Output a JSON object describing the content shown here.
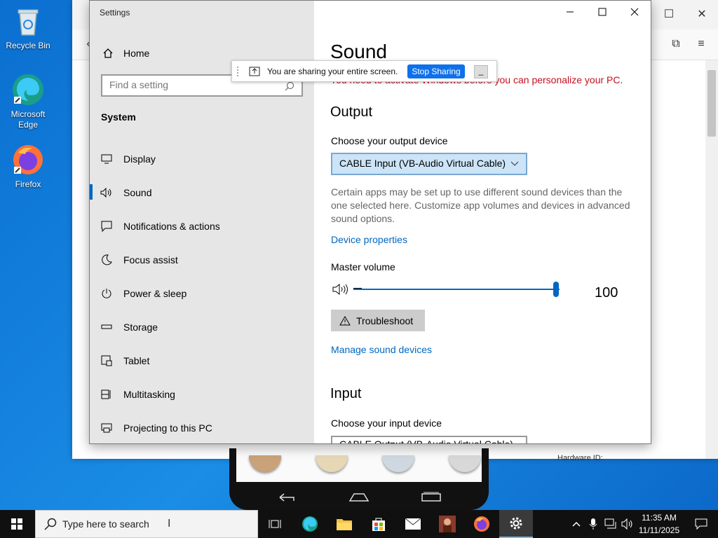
{
  "desktop": {
    "icons": [
      {
        "label": "Recycle Bin",
        "icon": "recycle-bin-icon"
      },
      {
        "label": "Microsoft Edge",
        "icon": "edge-icon"
      },
      {
        "label": "Firefox",
        "icon": "firefox-icon"
      }
    ]
  },
  "browser": {
    "hardware_id_text": "Hardware ID:"
  },
  "sharing_bar": {
    "message": "You are sharing your entire screen.",
    "stop_label": "Stop Sharing"
  },
  "settings": {
    "window_title": "Settings",
    "home_label": "Home",
    "search_placeholder": "Find a setting",
    "section_label": "System",
    "nav": [
      {
        "label": "Display",
        "icon": "display-icon"
      },
      {
        "label": "Sound",
        "icon": "sound-icon",
        "active": true
      },
      {
        "label": "Notifications & actions",
        "icon": "notifications-icon"
      },
      {
        "label": "Focus assist",
        "icon": "focus-assist-icon"
      },
      {
        "label": "Power & sleep",
        "icon": "power-icon"
      },
      {
        "label": "Storage",
        "icon": "storage-icon"
      },
      {
        "label": "Tablet",
        "icon": "tablet-icon"
      },
      {
        "label": "Multitasking",
        "icon": "multitasking-icon"
      },
      {
        "label": "Projecting to this PC",
        "icon": "projecting-icon"
      }
    ],
    "page_title": "Sound",
    "activation_warning": "You need to activate Windows before you can personalize your PC.",
    "output": {
      "heading": "Output",
      "choose_label": "Choose your output device",
      "selected_device": "CABLE Input (VB-Audio Virtual Cable)",
      "description": "Certain apps may be set up to use different sound devices than the one selected here. Customize app volumes and devices in advanced sound options.",
      "device_properties_link": "Device properties",
      "master_volume_label": "Master volume",
      "volume_value": "100",
      "volume_level_fraction": 1.0,
      "troubleshoot_label": "Troubleshoot",
      "manage_link": "Manage sound devices"
    },
    "input": {
      "heading": "Input",
      "choose_label": "Choose your input device",
      "selected_device": "CABLE Output (VB-Audio Virtual Cable)"
    }
  },
  "taskbar": {
    "search_placeholder": "Type here to search",
    "time": "11:35 AM",
    "date": "11/11/2025"
  }
}
